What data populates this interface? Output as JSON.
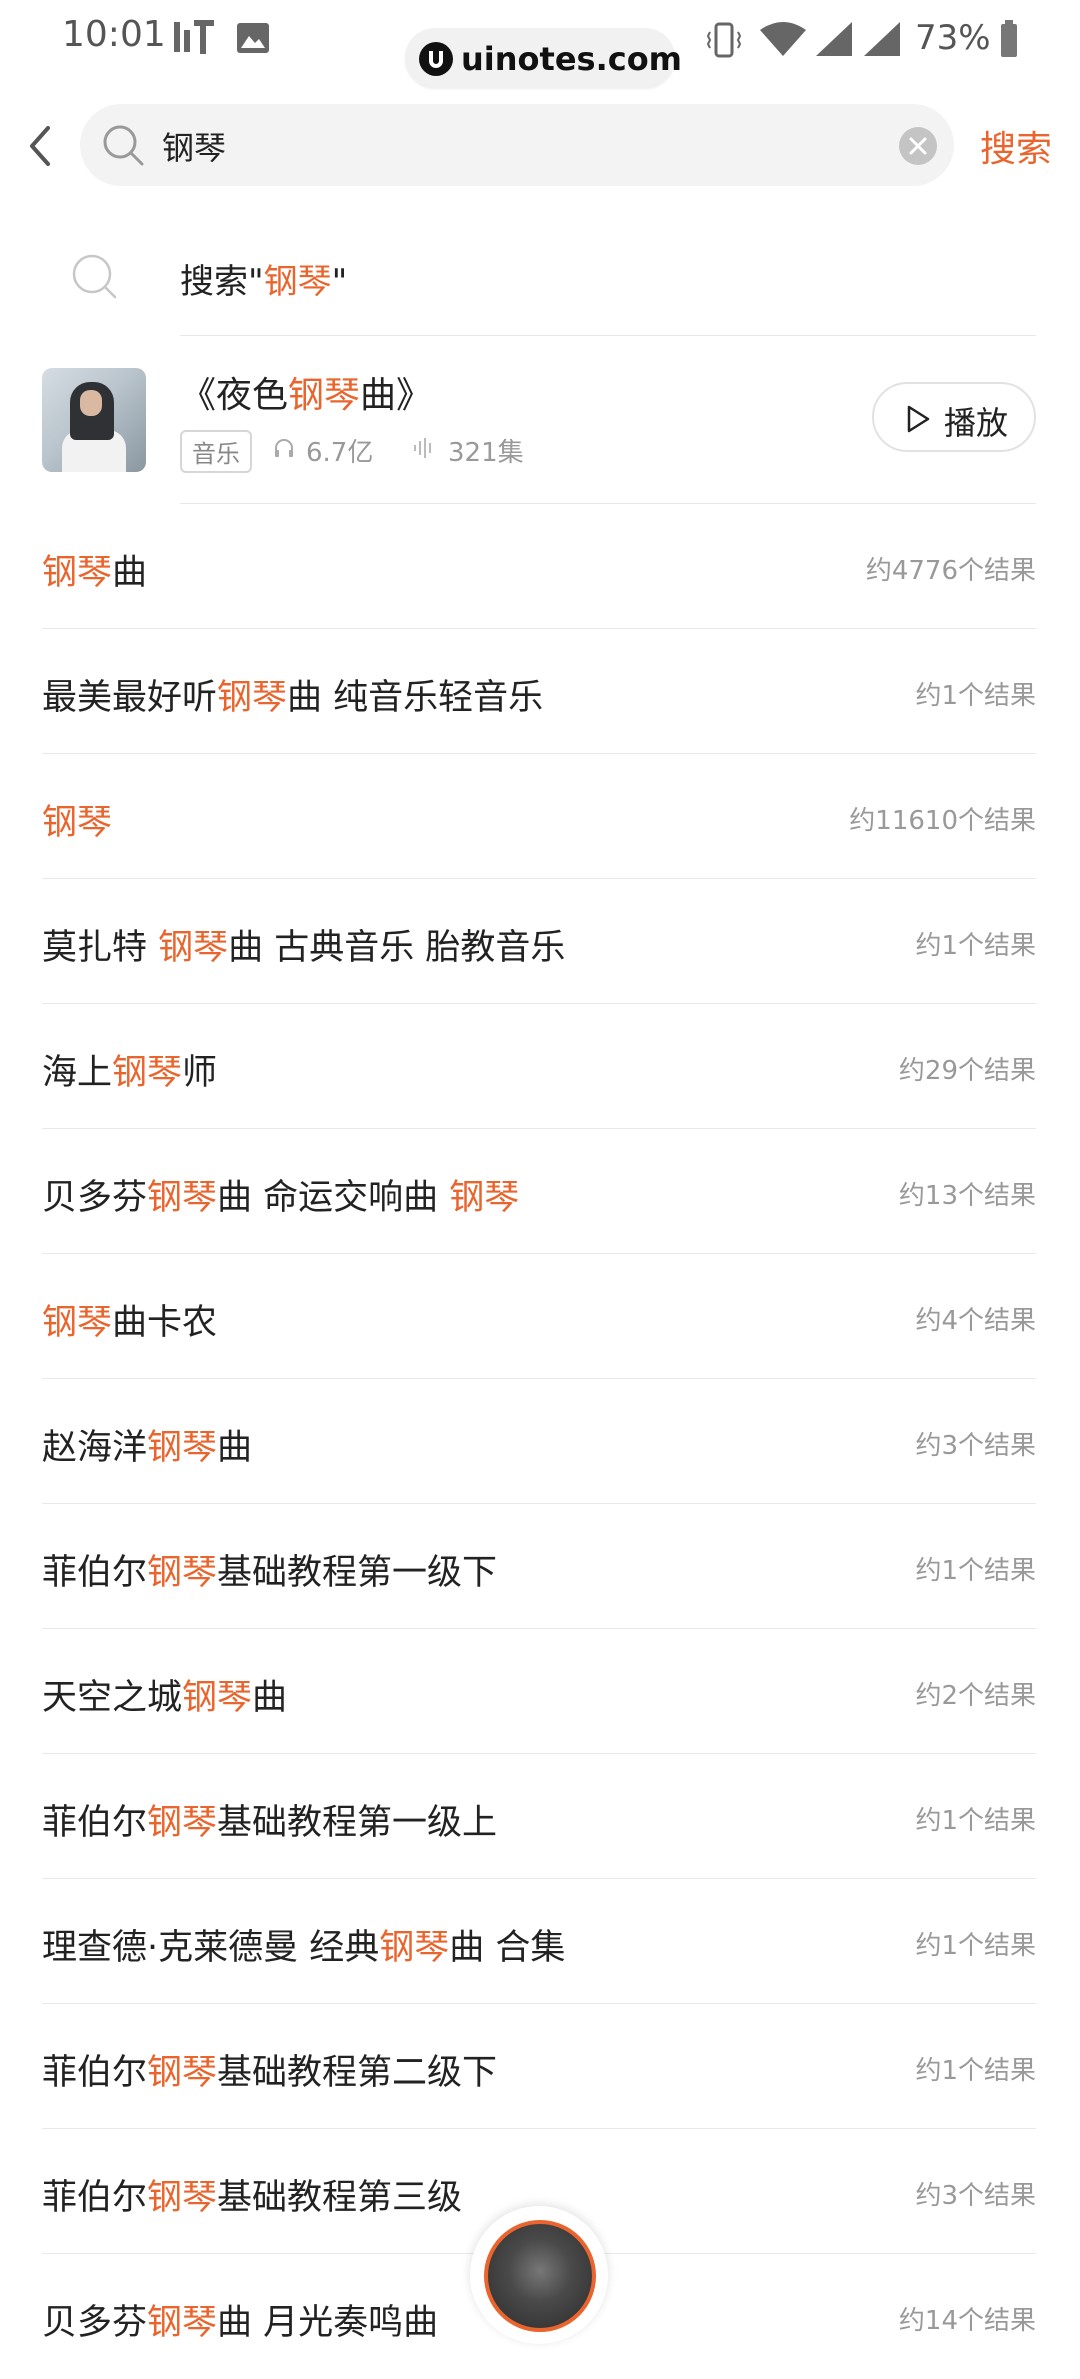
{
  "status_bar": {
    "time": "10:01",
    "battery": "73%",
    "watermark": "uinotes.com"
  },
  "search": {
    "query": "钢琴",
    "submit_label": "搜索"
  },
  "suggest": {
    "prefix": "搜索\"",
    "keyword": "钢琴",
    "suffix": "\""
  },
  "album": {
    "title_before": "《夜色",
    "title_keyword": "钢琴",
    "title_after": "曲》",
    "tag": "音乐",
    "plays": "6.7亿",
    "episodes": "321集",
    "play_label": "播放"
  },
  "results": [
    {
      "before": "",
      "kw": "钢琴",
      "after": "曲",
      "count": "约4776个结果"
    },
    {
      "before": "最美最好听",
      "kw": "钢琴",
      "after": "曲 纯音乐轻音乐",
      "count": "约1个结果"
    },
    {
      "before": "",
      "kw": "钢琴",
      "after": "",
      "count": "约11610个结果"
    },
    {
      "before": "莫扎特 ",
      "kw": "钢琴",
      "after": "曲 古典音乐 胎教音乐",
      "count": "约1个结果"
    },
    {
      "before": "海上",
      "kw": "钢琴",
      "after": "师",
      "count": "约29个结果"
    },
    {
      "before": "贝多芬",
      "kw": "钢琴",
      "after": "曲 命运交响曲 ",
      "kw2": "钢琴",
      "count": "约13个结果"
    },
    {
      "before": "",
      "kw": "钢琴",
      "after": "曲卡农",
      "count": "约4个结果"
    },
    {
      "before": "赵海洋",
      "kw": "钢琴",
      "after": "曲",
      "count": "约3个结果"
    },
    {
      "before": "菲伯尔",
      "kw": "钢琴",
      "after": "基础教程第一级下",
      "count": "约1个结果"
    },
    {
      "before": "天空之城",
      "kw": "钢琴",
      "after": "曲",
      "count": "约2个结果"
    },
    {
      "before": "菲伯尔",
      "kw": "钢琴",
      "after": "基础教程第一级上",
      "count": "约1个结果"
    },
    {
      "before": "理查德·克莱德曼 经典",
      "kw": "钢琴",
      "after": "曲 合集",
      "count": "约1个结果"
    },
    {
      "before": "菲伯尔",
      "kw": "钢琴",
      "after": "基础教程第二级下",
      "count": "约1个结果"
    },
    {
      "before": "菲伯尔",
      "kw": "钢琴",
      "after": "基础教程第三级",
      "count": "约3个结果"
    },
    {
      "before": "贝多芬",
      "kw": "钢琴",
      "after": "曲 月光奏鸣曲",
      "count": "约14个结果"
    }
  ],
  "colors": {
    "accent": "#e9652d",
    "text": "#222222",
    "muted": "#999999"
  }
}
